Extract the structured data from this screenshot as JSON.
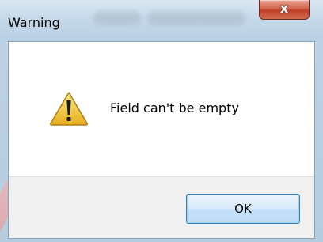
{
  "dialog": {
    "title": "Warning",
    "close_glyph": "x",
    "message": "Field can't be empty",
    "ok_label": "OK",
    "icon": "warning-icon"
  },
  "colors": {
    "close_button": "#c7452e",
    "ok_border": "#3c7fb1",
    "warning_yellow": "#f2c534"
  }
}
